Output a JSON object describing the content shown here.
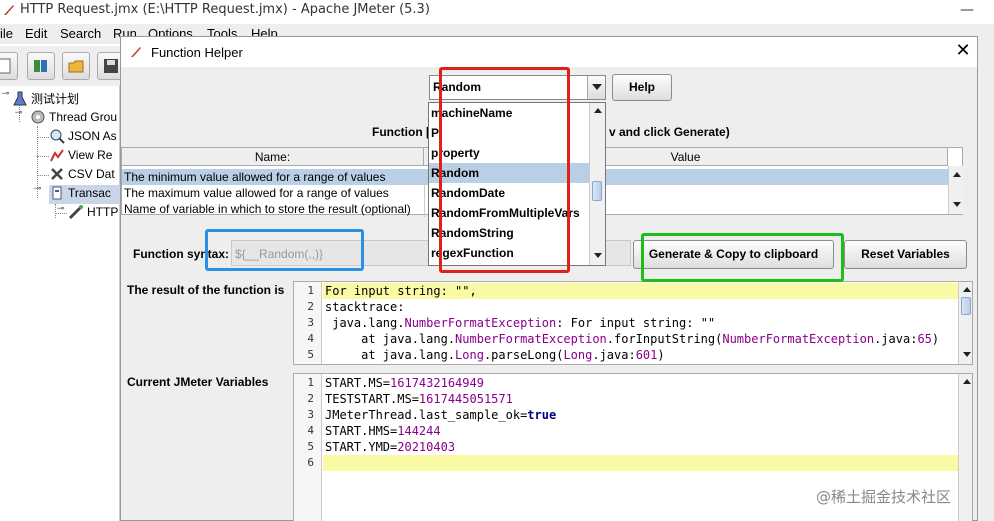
{
  "window": {
    "title": "HTTP Request.jmx (E:\\HTTP Request.jmx) - Apache JMeter (5.3)",
    "minimize": "—"
  },
  "menu": [
    "ile",
    "Edit",
    "Search",
    "Run",
    "Options",
    "Tools",
    "Help"
  ],
  "toolbar": {
    "buttons": [
      "new-icon",
      "templates-icon",
      "open-icon",
      "save-icon"
    ]
  },
  "tree": {
    "items": [
      {
        "label": "测试计划",
        "icon": "test-plan-icon"
      },
      {
        "label": "Thread Grou",
        "icon": "thread-group-icon"
      },
      {
        "label": "JSON As",
        "icon": "json-assertion-icon"
      },
      {
        "label": "View Re",
        "icon": "view-results-icon"
      },
      {
        "label": "CSV Dat",
        "icon": "csv-data-icon"
      },
      {
        "label": "Transac",
        "icon": "transaction-controller-icon"
      },
      {
        "label": "HTTP",
        "icon": "http-sampler-icon"
      }
    ]
  },
  "dialog": {
    "title": "Function Helper",
    "close": "✕",
    "function_combo": {
      "value": "Random"
    },
    "help_button": "Help",
    "params_label_left": "Function [P",
    "params_label_right": "v and click Generate)",
    "table": {
      "headers": [
        "Name:",
        "Value"
      ],
      "rows": [
        "The minimum value allowed for a range of values",
        "The maximum value allowed for a range of values",
        "Name of variable in which to store the result (optional)"
      ]
    },
    "function_syntax_label": "Function syntax:",
    "function_syntax_value": "${__Random(,,)}",
    "generate_button": "Generate & Copy to clipboard",
    "reset_button": "Reset Variables",
    "result_label": "The result of the function is",
    "result_lines": [
      {
        "n": "1",
        "text": "For input string: \"\","
      },
      {
        "n": "2",
        "text": "stacktrace:"
      },
      {
        "n": "3",
        "pre": " java.lang.",
        "cls": "NumberFormatException",
        "post": ": For input string: \"\""
      },
      {
        "n": "4",
        "pre": "     at java.lang.",
        "cls": "NumberFormatException",
        "mid": ".forInputString(",
        "cls2": "NumberFormatException",
        "tail": ".java:",
        "num": "65",
        "end": ")"
      },
      {
        "n": "5",
        "pre": "     at java.lang.",
        "cls": "Long",
        "mid": ".parseLong(",
        "cls2": "Long",
        "tail": ".java:",
        "num": "601",
        "end": ")"
      }
    ],
    "variables_label": "Current JMeter Variables",
    "variable_lines": [
      {
        "n": "1",
        "key": "START.MS=",
        "val": "1617432164949"
      },
      {
        "n": "2",
        "key": "TESTSTART.MS=",
        "val": "1617445051571"
      },
      {
        "n": "3",
        "key": "JMeterThread.last_sample_ok=",
        "val": "true"
      },
      {
        "n": "4",
        "key": "START.HMS=",
        "val": "144244"
      },
      {
        "n": "5",
        "key": "START.YMD=",
        "val": "20210403"
      },
      {
        "n": "6",
        "key": "",
        "val": ""
      }
    ],
    "dropdown_options": [
      "machineName",
      "P",
      "property",
      "Random",
      "RandomDate",
      "RandomFromMultipleVars",
      "RandomString",
      "regexFunction"
    ],
    "dropdown_selected": "Random"
  },
  "annotations": {
    "red": "#e0201b",
    "green": "#1ebd1e",
    "blue": "#2a8fe6"
  },
  "watermark": "@稀土掘金技术社区"
}
